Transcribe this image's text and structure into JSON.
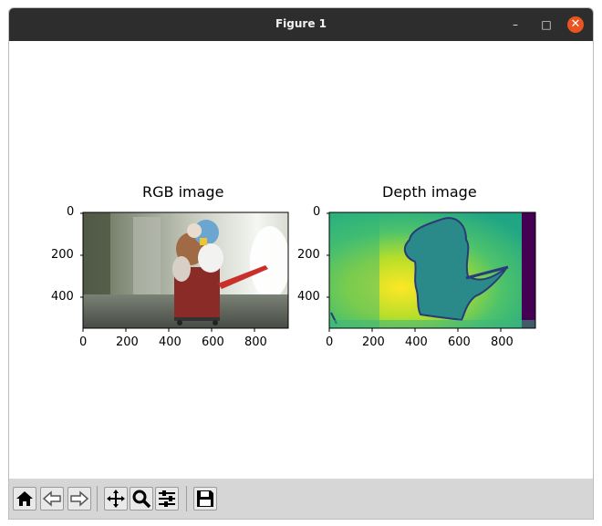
{
  "window": {
    "title": "Figure 1",
    "controls": {
      "minimize": "–",
      "maximize": "□",
      "close": "✕"
    }
  },
  "figure": {
    "axes": [
      {
        "title": "RGB image",
        "x_ticks": [
          "0",
          "200",
          "400",
          "600",
          "800"
        ],
        "y_ticks": [
          "0",
          "200",
          "400"
        ],
        "image": "rgb-photo"
      },
      {
        "title": "Depth image",
        "x_ticks": [
          "0",
          "200",
          "400",
          "600",
          "800"
        ],
        "y_ticks": [
          "0",
          "200",
          "400"
        ],
        "image": "depth-map"
      }
    ]
  },
  "toolbar": {
    "buttons": [
      {
        "name": "home",
        "icon": "home-icon"
      },
      {
        "name": "back",
        "icon": "arrow-left-icon"
      },
      {
        "name": "forward",
        "icon": "arrow-right-icon"
      },
      {
        "name": "pan",
        "icon": "move-icon"
      },
      {
        "name": "zoom",
        "icon": "magnifier-icon"
      },
      {
        "name": "configure",
        "icon": "sliders-icon"
      },
      {
        "name": "save",
        "icon": "floppy-disk-icon"
      }
    ]
  }
}
